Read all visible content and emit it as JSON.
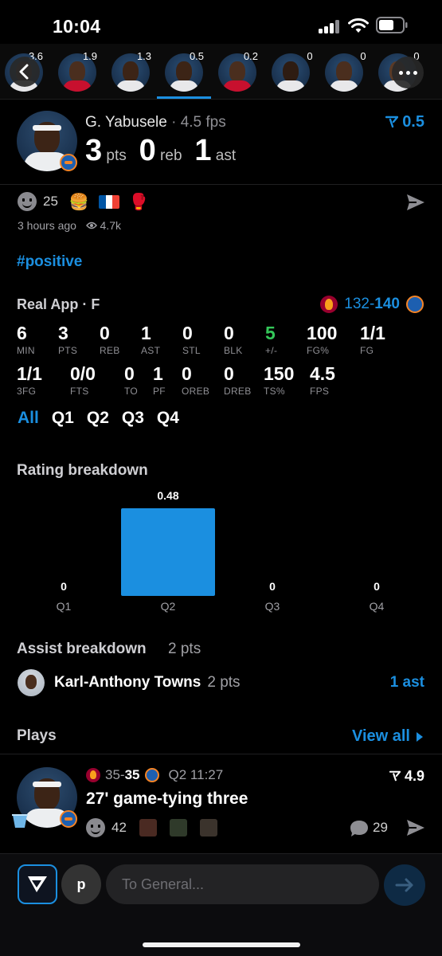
{
  "status_bar": {
    "time": "10:04"
  },
  "player_strip": [
    {
      "value": "3.6"
    },
    {
      "value": "1.9"
    },
    {
      "value": "1.3"
    },
    {
      "value": "0.5"
    },
    {
      "value": "0.2"
    },
    {
      "value": "0"
    },
    {
      "value": "0"
    },
    {
      "value": "0"
    }
  ],
  "player": {
    "name": "G. Yabusele",
    "fps": "4.5 fps",
    "pts": "3",
    "pts_label": "pts",
    "reb": "0",
    "reb_label": "reb",
    "ast": "1",
    "ast_label": "ast",
    "rating": "0.5"
  },
  "post": {
    "reaction_count": "25",
    "time_ago": "3 hours ago",
    "views": "4.7k",
    "hashtag": "#positive"
  },
  "box_score": {
    "app_label": "Real App · F",
    "away_score": "132",
    "home_score": "140",
    "stats": [
      {
        "value": "6",
        "label": "MIN"
      },
      {
        "value": "3",
        "label": "PTS"
      },
      {
        "value": "0",
        "label": "REB"
      },
      {
        "value": "1",
        "label": "AST"
      },
      {
        "value": "0",
        "label": "STL"
      },
      {
        "value": "0",
        "label": "BLK"
      },
      {
        "value": "5",
        "label": "+/-"
      },
      {
        "value": "100",
        "label": "FG%"
      },
      {
        "value": "1/1",
        "label": "FG"
      },
      {
        "value": "1/1",
        "label": "3FG"
      },
      {
        "value": "0/0",
        "label": "FTS"
      },
      {
        "value": "0",
        "label": "TO"
      },
      {
        "value": "1",
        "label": "PF"
      },
      {
        "value": "0",
        "label": "OREB"
      },
      {
        "value": "0",
        "label": "DREB"
      },
      {
        "value": "150",
        "label": "TS%"
      },
      {
        "value": "4.5",
        "label": "FPS"
      }
    ],
    "tabs": [
      "All",
      "Q1",
      "Q2",
      "Q3",
      "Q4"
    ]
  },
  "rating_breakdown": {
    "title": "Rating breakdown"
  },
  "chart_data": {
    "type": "bar",
    "categories": [
      "Q1",
      "Q2",
      "Q3",
      "Q4"
    ],
    "values": [
      0,
      0.48,
      0,
      0
    ],
    "value_labels": [
      "0",
      "0.48",
      "0",
      "0"
    ],
    "color": "#1b8fe0",
    "grid": false
  },
  "assist_breakdown": {
    "title": "Assist breakdown",
    "total": "2 pts",
    "player_name": "Karl-Anthony Towns",
    "player_pts": "2 pts",
    "player_ast": "1 ast"
  },
  "plays": {
    "title": "Plays",
    "view_all": "View all",
    "item": {
      "away": "35",
      "home": "35",
      "clock": "Q2 11:27",
      "rating": "4.9",
      "title": "27' game-tying three",
      "reactions": "42",
      "comments": "29"
    }
  },
  "composer": {
    "user_initial": "p",
    "placeholder": "To General..."
  },
  "colors": {
    "accent": "#1b8fe0",
    "positive": "#34c759",
    "background": "#000000"
  },
  "icons": [
    "back-icon",
    "more-icon",
    "filter-icon",
    "send-icon",
    "eye-icon",
    "comment-icon",
    "chevron-right-icon",
    "arrow-right-icon"
  ]
}
